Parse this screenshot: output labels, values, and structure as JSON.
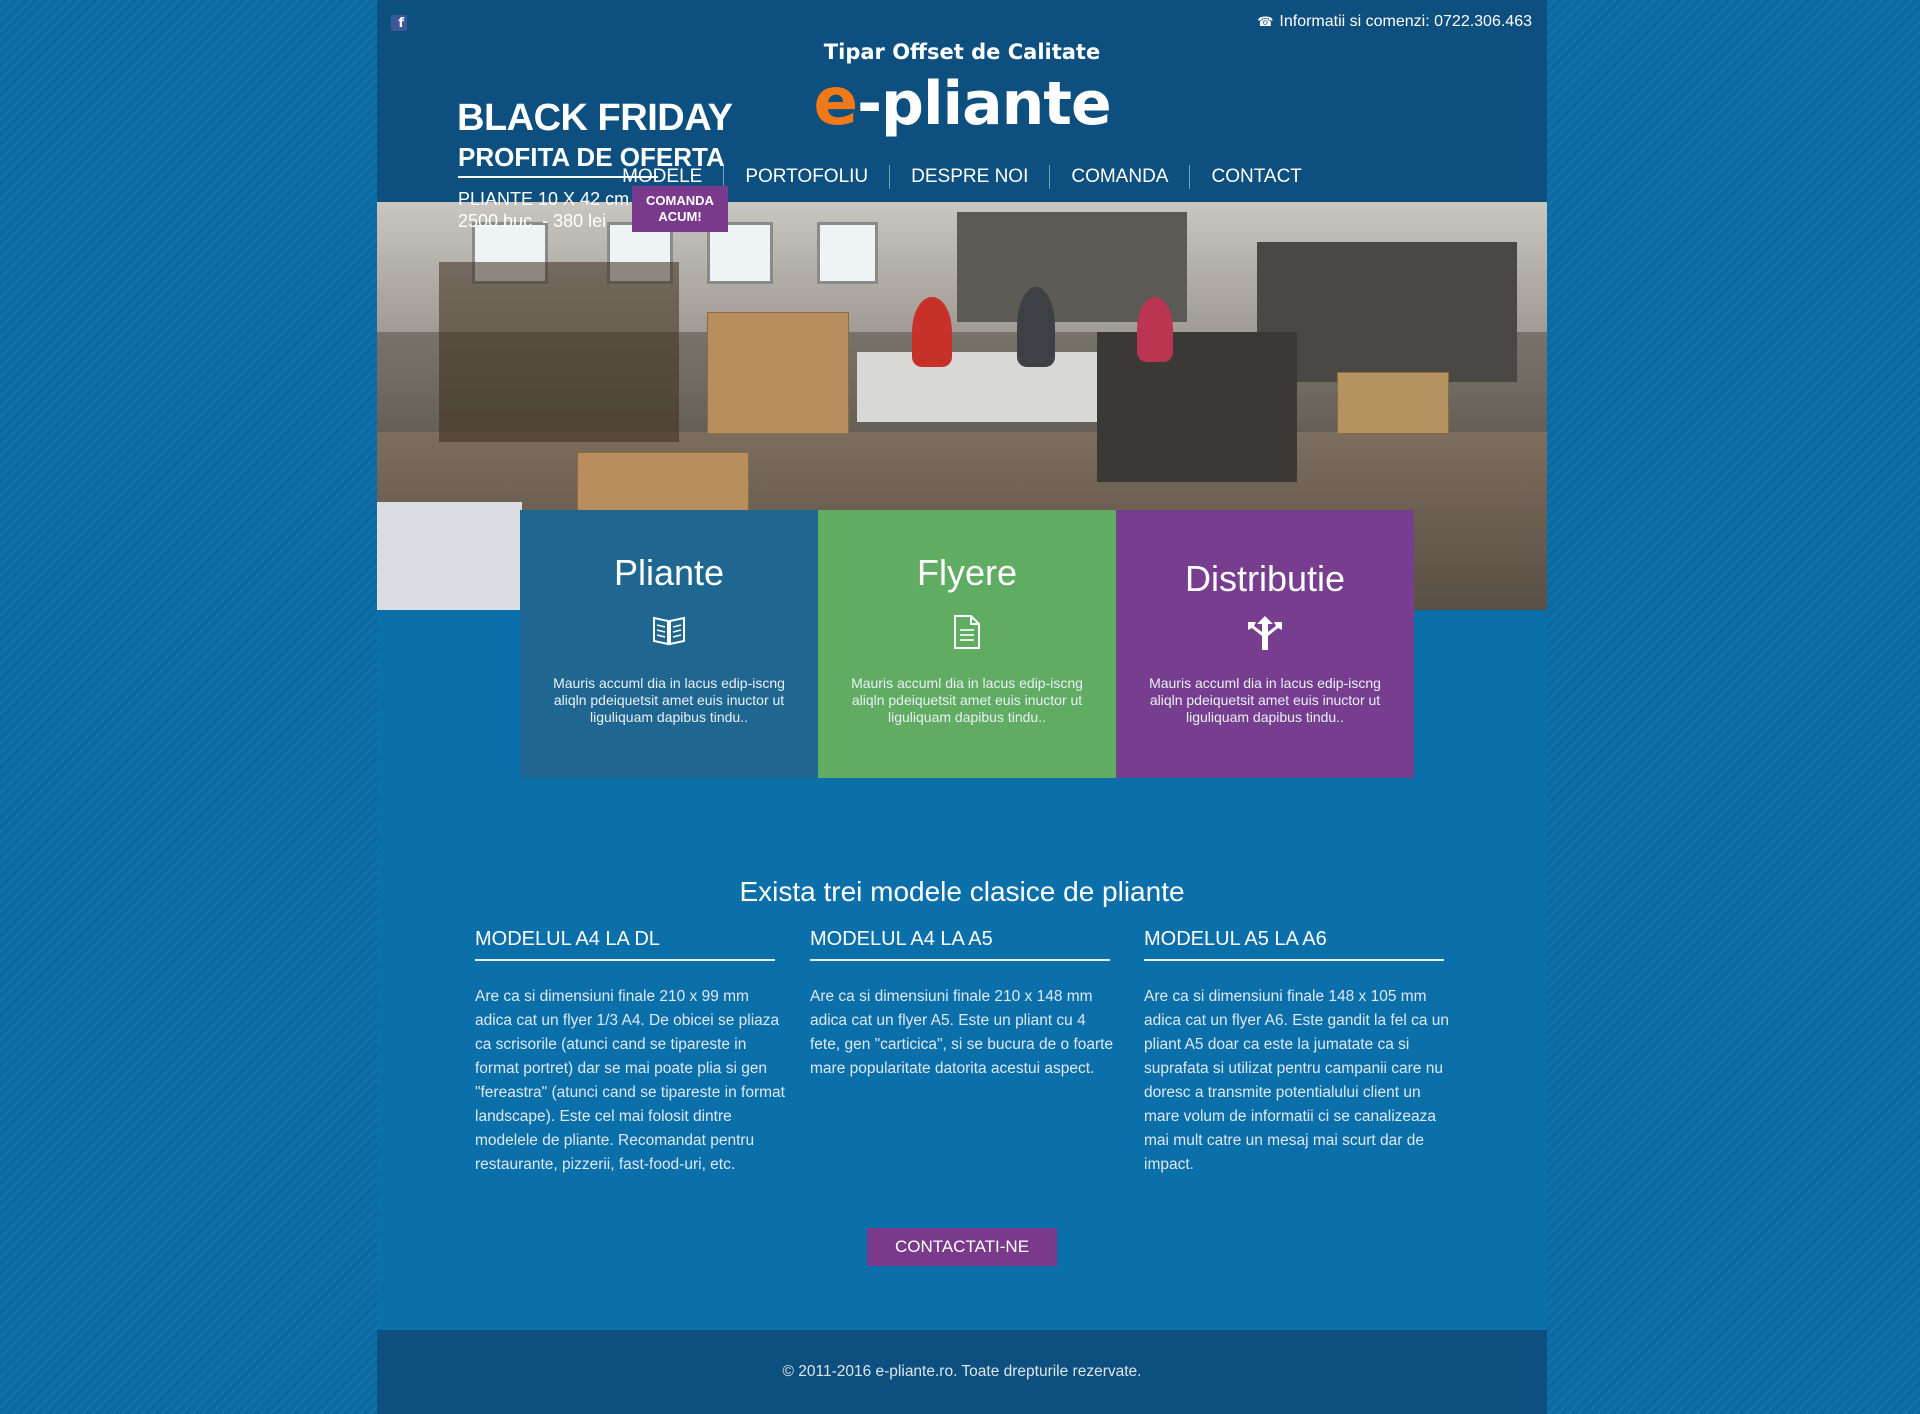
{
  "header": {
    "phone_text": "Informatii si comenzi: 0722.306.463",
    "tagline": "Tipar Offset de Calitate",
    "logo_prefix": "e",
    "logo_suffix": "-pliante"
  },
  "nav": {
    "items": [
      {
        "label": "MODELE"
      },
      {
        "label": "PORTOFOLIU"
      },
      {
        "label": "DESPRE NOI"
      },
      {
        "label": "COMANDA"
      },
      {
        "label": "CONTACT"
      }
    ]
  },
  "hero": {
    "title": "BLACK FRIDAY",
    "subtitle": "PROFITA DE OFERTA",
    "offer_line1": "PLIANTE 10 X 42 cm",
    "offer_line2": "2500 buc. - 380 lei",
    "cta_line1": "COMANDA",
    "cta_line2": "ACUM!"
  },
  "cards": [
    {
      "title": "Pliante",
      "icon": "book-icon",
      "color": "#1f6791",
      "text": "Mauris accuml dia in lacus edip-iscng aliqln pdeiquetsit amet euis inuctor ut liguliquam dapibus tindu.."
    },
    {
      "title": "Flyere",
      "icon": "document-icon",
      "color": "#60ac63",
      "text": "Mauris accuml dia in lacus edip-iscng aliqln pdeiquetsit amet euis inuctor ut liguliquam dapibus tindu.."
    },
    {
      "title": "Distributie",
      "icon": "split-arrows-icon",
      "color": "#773d8e",
      "text": "Mauris accuml dia in lacus edip-iscng aliqln pdeiquetsit amet euis inuctor ut liguliquam dapibus tindu.."
    }
  ],
  "models": {
    "title": "Exista trei modele clasice de pliante",
    "columns": [
      {
        "title": "MODELUL A4 LA DL",
        "text": "Are ca si dimensiuni finale 210 x 99 mm adica cat un flyer 1/3 A4. De obicei se pliaza ca scrisorile (atunci cand se tipareste in format portret) dar se mai poate plia si gen \"fereastra\" (atunci cand se tipareste in format landscape). Este cel mai folosit dintre modelele de pliante. Recomandat pentru restaurante, pizzerii, fast-food-uri, etc."
      },
      {
        "title": "MODELUL A4 LA A5",
        "text": "Are ca si dimensiuni finale 210 x 148 mm adica cat un flyer A5. Este un pliant cu 4 fete, gen \"carticica\", si se bucura de o foarte mare popularitate datorita acestui aspect."
      },
      {
        "title": "MODELUL A5 LA A6",
        "text": "Are ca si dimensiuni finale 148 x 105 mm adica cat un flyer A6. Este gandit la fel ca un pliant A5 doar ca este la jumatate ca si suprafata si utilizat pentru campanii care nu doresc a transmite potentialului client un mare volum de informatii ci se canalizeaza mai mult catre un mesaj mai scurt dar de impact."
      }
    ],
    "cta": "CONTACTATI-NE"
  },
  "footer": {
    "text": "© 2011-2016 e-pliante.ro. Toate drepturile rezervate."
  },
  "colors": {
    "accent_orange": "#f07a1a",
    "purple": "#7a3a8c",
    "header_blue": "#0d4f7e",
    "page_blue": "#0b6fa9"
  }
}
